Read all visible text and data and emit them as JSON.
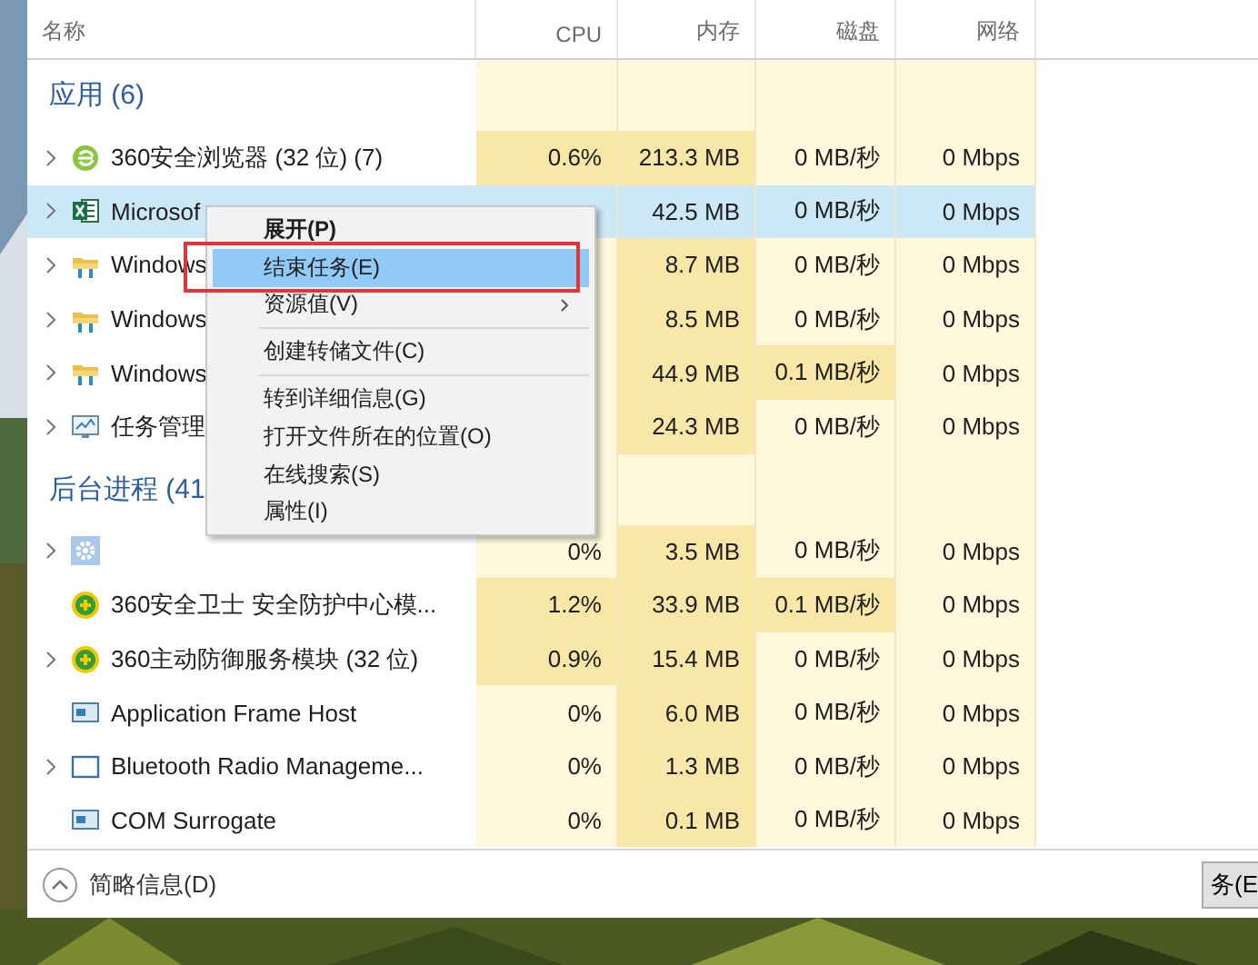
{
  "columns": [
    {
      "label": "名称"
    },
    {
      "label": "CPU"
    },
    {
      "label": "内存"
    },
    {
      "label": "磁盘"
    },
    {
      "label": "网络"
    }
  ],
  "groups": [
    {
      "title": "应用 (6)",
      "rows": [
        {
          "name": "360安全浏览器 (32 位) (7)",
          "kind": "browser",
          "expandable": true,
          "selected": false,
          "cpu": {
            "text": "0.6%",
            "highlight": true
          },
          "memory": {
            "text": "213.3 MB",
            "highlight": true
          },
          "disk": {
            "text": "0 MB/秒",
            "highlight": false
          },
          "network": {
            "text": "0 Mbps",
            "highlight": false
          }
        },
        {
          "name": "Microsof",
          "kind": "sheet",
          "expandable": true,
          "selected": true,
          "memory": {
            "text": "42.5 MB",
            "highlight": false
          },
          "disk": {
            "text": "0 MB/秒",
            "highlight": false
          },
          "network": {
            "text": "0 Mbps",
            "highlight": false
          }
        },
        {
          "name": "Windows",
          "kind": "folder",
          "expandable": true,
          "selected": false,
          "memory": {
            "text": "8.7 MB",
            "highlight": true
          },
          "disk": {
            "text": "0 MB/秒",
            "highlight": false
          },
          "network": {
            "text": "0 Mbps",
            "highlight": false
          }
        },
        {
          "name": "Windows",
          "kind": "folder",
          "expandable": true,
          "selected": false,
          "memory": {
            "text": "8.5 MB",
            "highlight": true
          },
          "disk": {
            "text": "0 MB/秒",
            "highlight": false
          },
          "network": {
            "text": "0 Mbps",
            "highlight": false
          }
        },
        {
          "name": "Windows",
          "kind": "folder",
          "expandable": true,
          "selected": false,
          "memory": {
            "text": "44.9 MB",
            "highlight": true
          },
          "disk": {
            "text": "0.1 MB/秒",
            "highlight": true
          },
          "network": {
            "text": "0 Mbps",
            "highlight": false
          }
        },
        {
          "name": "任务管理",
          "kind": "monitor",
          "expandable": true,
          "selected": false,
          "memory": {
            "text": "24.3 MB",
            "highlight": true
          },
          "disk": {
            "text": "0 MB/秒",
            "highlight": false
          },
          "network": {
            "text": "0 Mbps",
            "highlight": false
          }
        }
      ]
    },
    {
      "title": "后台进程 (41",
      "rows": [
        {
          "name": "",
          "kind": "gear",
          "expandable": true,
          "selected": false,
          "cpu": {
            "text": "0%",
            "highlight": false
          },
          "memory": {
            "text": "3.5 MB",
            "highlight": true
          },
          "disk": {
            "text": "0 MB/秒",
            "highlight": false
          },
          "network": {
            "text": "0 Mbps",
            "highlight": false
          }
        },
        {
          "name": "360安全卫士 安全防护中心模...",
          "kind": "shield",
          "expandable": false,
          "selected": false,
          "cpu": {
            "text": "1.2%",
            "highlight": true
          },
          "memory": {
            "text": "33.9 MB",
            "highlight": true
          },
          "disk": {
            "text": "0.1 MB/秒",
            "highlight": true
          },
          "network": {
            "text": "0 Mbps",
            "highlight": false
          }
        },
        {
          "name": "360主动防御服务模块 (32 位)",
          "kind": "shield",
          "expandable": true,
          "selected": false,
          "cpu": {
            "text": "0.9%",
            "highlight": true
          },
          "memory": {
            "text": "15.4 MB",
            "highlight": true
          },
          "disk": {
            "text": "0 MB/秒",
            "highlight": false
          },
          "network": {
            "text": "0 Mbps",
            "highlight": false
          }
        },
        {
          "name": "Application Frame Host",
          "kind": "frame",
          "expandable": false,
          "selected": false,
          "cpu": {
            "text": "0%",
            "highlight": false
          },
          "memory": {
            "text": "6.0 MB",
            "highlight": true
          },
          "disk": {
            "text": "0 MB/秒",
            "highlight": false
          },
          "network": {
            "text": "0 Mbps",
            "highlight": false
          }
        },
        {
          "name": "Bluetooth Radio Manageme...",
          "kind": "window",
          "expandable": true,
          "selected": false,
          "cpu": {
            "text": "0%",
            "highlight": false
          },
          "memory": {
            "text": "1.3 MB",
            "highlight": true
          },
          "disk": {
            "text": "0 MB/秒",
            "highlight": false
          },
          "network": {
            "text": "0 Mbps",
            "highlight": false
          }
        },
        {
          "name": "COM Surrogate",
          "kind": "frame",
          "expandable": false,
          "selected": false,
          "cpu": {
            "text": "0%",
            "highlight": false
          },
          "memory": {
            "text": "0.1 MB",
            "highlight": true
          },
          "disk": {
            "text": "0 MB/秒",
            "highlight": false
          },
          "network": {
            "text": "0 Mbps",
            "highlight": false
          }
        }
      ]
    }
  ],
  "context_menu": {
    "items": [
      {
        "label": "展开(P)",
        "kind": "bold",
        "selected": false,
        "submenu": false
      },
      {
        "label": "结束任务(E)",
        "kind": "plain",
        "selected": true,
        "submenu": false,
        "framed": true
      },
      {
        "label": "资源值(V)",
        "kind": "plain",
        "selected": false,
        "submenu": true
      },
      {
        "kind": "separator"
      },
      {
        "label": "创建转储文件(C)",
        "kind": "plain",
        "selected": false,
        "submenu": false
      },
      {
        "kind": "separator"
      },
      {
        "label": "转到详细信息(G)",
        "kind": "plain",
        "selected": false,
        "submenu": false
      },
      {
        "label": "打开文件所在的位置(O)",
        "kind": "plain",
        "selected": false,
        "submenu": false
      },
      {
        "label": "在线搜索(S)",
        "kind": "plain",
        "selected": false,
        "submenu": false
      },
      {
        "label": "属性(I)",
        "kind": "plain",
        "selected": false,
        "submenu": false
      }
    ]
  },
  "footer": {
    "details_toggle": "简略信息(D)",
    "end_task_button": "务(E"
  }
}
